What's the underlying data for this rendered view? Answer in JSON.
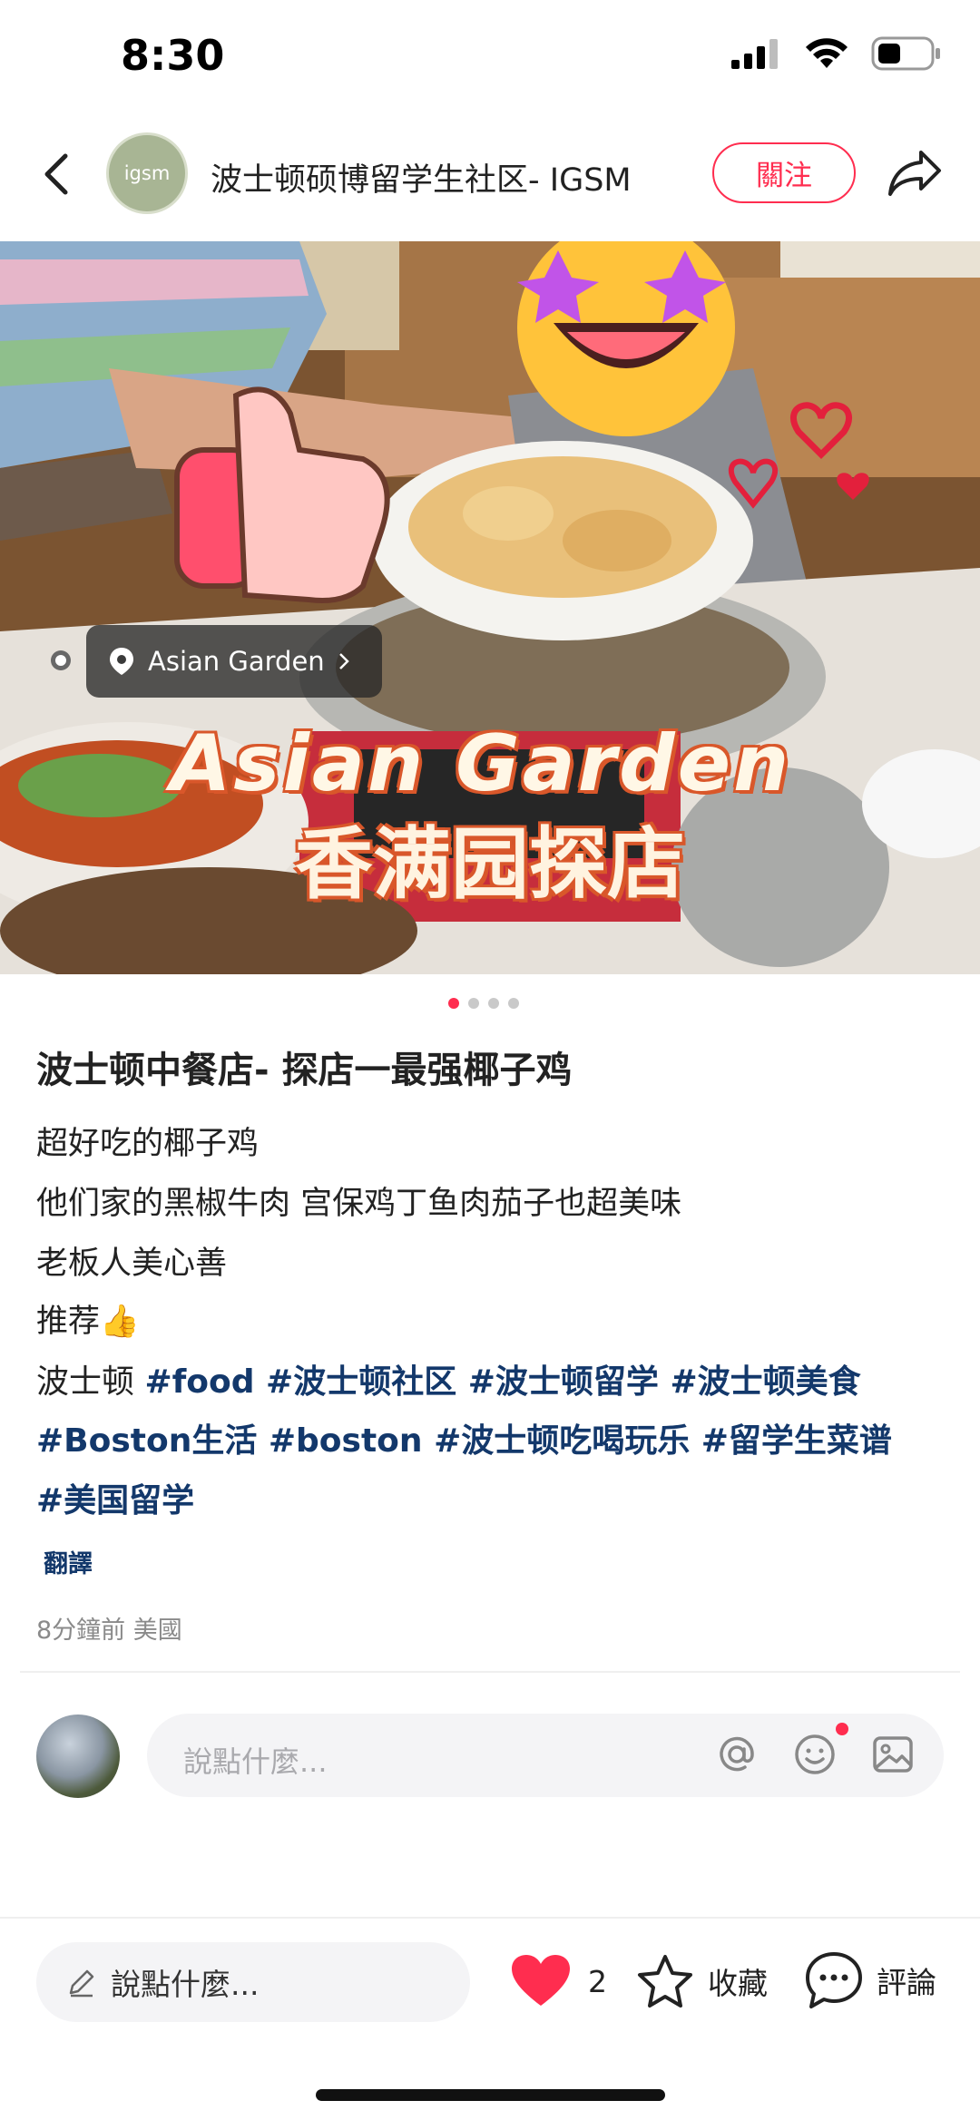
{
  "status_bar": {
    "time": "8:30"
  },
  "header": {
    "avatar_text": "igsm",
    "title": "波士顿硕博留学生社区- IGSM",
    "follow_label": "關注"
  },
  "photo": {
    "location": "Asian Garden",
    "overlay_line1": "Asian Garden",
    "overlay_line2": "香满园探店",
    "page_count": 4,
    "current_page": 1
  },
  "post": {
    "title": "波士顿中餐店- 探店一最强椰子鸡",
    "lines": [
      "超好吃的椰子鸡",
      "他们家的黑椒牛肉 宫保鸡丁鱼肉茄子也超美味",
      "老板人美心善",
      "推荐👍"
    ],
    "tag_line1": {
      "plain": "波士顿 ",
      "tags": "#food #波士顿社区 #波士顿留学 #波士顿美食"
    },
    "tag_line2": "#Boston生活 #boston #波士顿吃喝玩乐 #留学生菜谱",
    "tag_line3": "#美国留学",
    "translate_label": "翻譯",
    "meta": "8分鐘前 美國"
  },
  "comment": {
    "placeholder": "說點什麼..."
  },
  "bottom_bar": {
    "input_label": "說點什麼...",
    "like_count": "2",
    "favorite_label": "收藏",
    "comment_label": "評論"
  },
  "colors": {
    "accent": "#ff2d4f",
    "hashtag": "#13386b"
  }
}
